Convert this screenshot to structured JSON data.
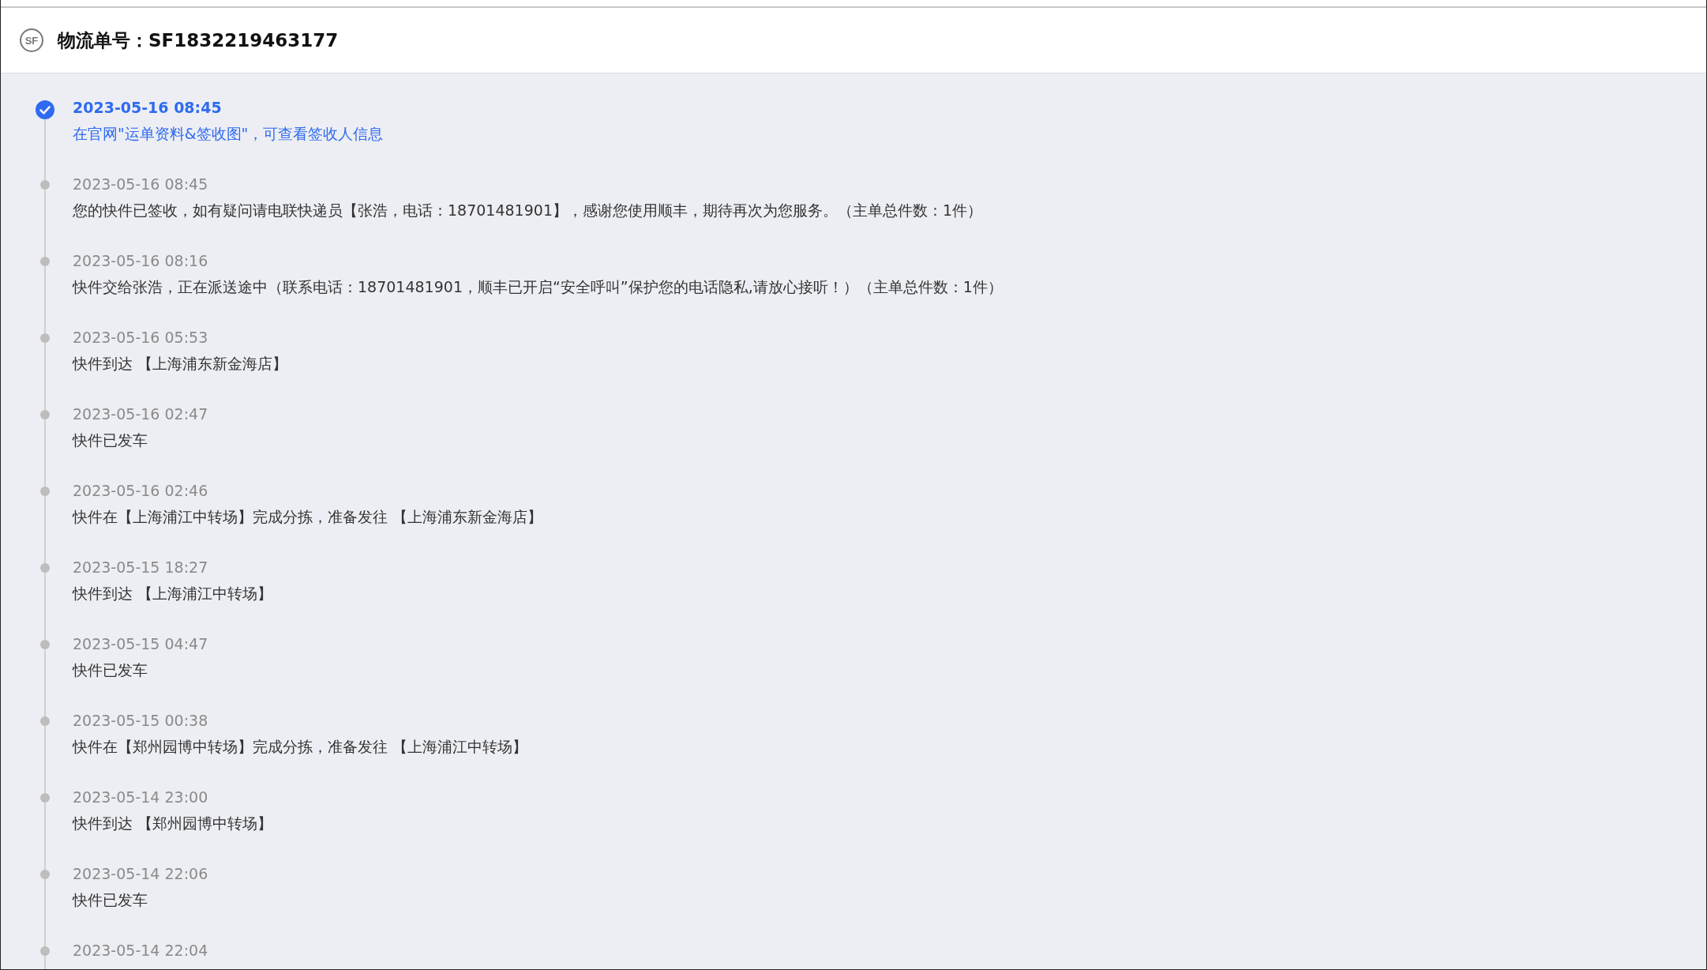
{
  "header": {
    "logo": "SF",
    "title": "物流单号：SF1832219463177"
  },
  "events": [
    {
      "kind": "signed",
      "time": "2023-05-16 08:45",
      "text": "在官网\"运单资料&签收图\"，可查看签收人信息"
    },
    {
      "kind": "normal",
      "time": "2023-05-16 08:45",
      "text": "您的快件已签收，如有疑问请电联快递员【张浩，电话：18701481901】，感谢您使用顺丰，期待再次为您服务。（主单总件数：1件）"
    },
    {
      "kind": "normal",
      "time": "2023-05-16 08:16",
      "text": "快件交给张浩，正在派送途中（联系电话：18701481901，顺丰已开启“安全呼叫”保护您的电话隐私,请放心接听！）（主单总件数：1件）"
    },
    {
      "kind": "normal",
      "time": "2023-05-16 05:53",
      "text": "快件到达 【上海浦东新金海店】"
    },
    {
      "kind": "normal",
      "time": "2023-05-16 02:47",
      "text": "快件已发车"
    },
    {
      "kind": "normal",
      "time": "2023-05-16 02:46",
      "text": "快件在【上海浦江中转场】完成分拣，准备发往 【上海浦东新金海店】"
    },
    {
      "kind": "normal",
      "time": "2023-05-15 18:27",
      "text": "快件到达 【上海浦江中转场】"
    },
    {
      "kind": "normal",
      "time": "2023-05-15 04:47",
      "text": "快件已发车"
    },
    {
      "kind": "normal",
      "time": "2023-05-15 00:38",
      "text": "快件在【郑州园博中转场】完成分拣，准备发往 【上海浦江中转场】"
    },
    {
      "kind": "normal",
      "time": "2023-05-14 23:00",
      "text": "快件到达 【郑州园博中转场】"
    },
    {
      "kind": "normal",
      "time": "2023-05-14 22:06",
      "text": "快件已发车"
    },
    {
      "kind": "normal",
      "time": "2023-05-14 22:04"
    }
  ]
}
